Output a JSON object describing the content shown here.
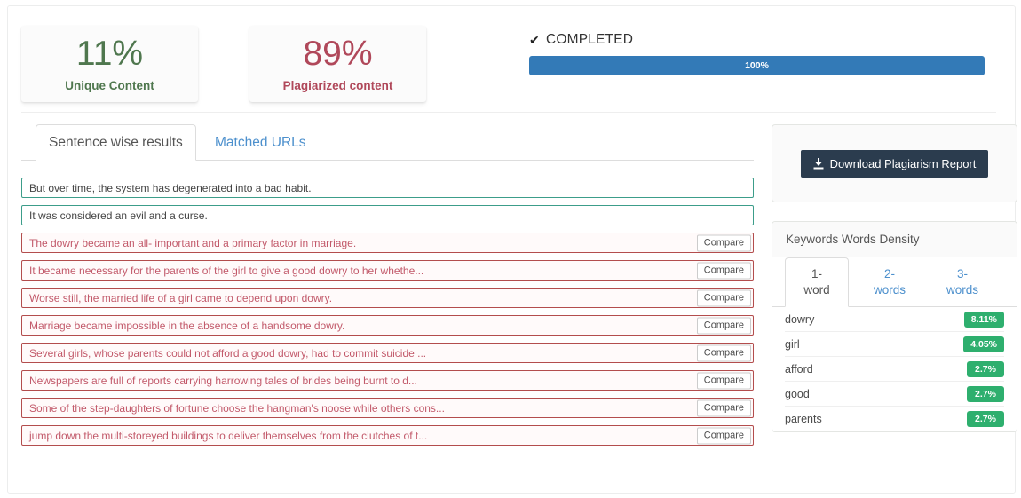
{
  "stats": {
    "unique": {
      "value": "11%",
      "label": "Unique Content",
      "color": "#4f774e"
    },
    "plagiarized": {
      "value": "89%",
      "label": "Plagiarized content",
      "color": "#b0485a"
    }
  },
  "status": {
    "check_icon": "✔",
    "label": "COMPLETED",
    "progress_text": "100%",
    "progress_percent": 100,
    "progress_color": "#337ab7"
  },
  "tabs": [
    {
      "label": "Sentence wise results",
      "active": true
    },
    {
      "label": "Matched URLs",
      "active": false
    }
  ],
  "sentences": [
    {
      "text": "But over time, the system has degenerated into a bad habit.",
      "status": "unique",
      "compare": null
    },
    {
      "text": "It was considered an evil and a curse.",
      "status": "unique",
      "compare": null
    },
    {
      "text": "The dowry became an all- important and a primary factor in marriage.",
      "status": "plagiarized",
      "compare": "Compare"
    },
    {
      "text": "It became necessary for the parents of the girl to give a good dowry to her whethe...",
      "status": "plagiarized",
      "compare": "Compare"
    },
    {
      "text": "Worse still, the married life of a girl came to depend upon dowry.",
      "status": "plagiarized",
      "compare": "Compare"
    },
    {
      "text": "Marriage became impossible in the absence of a handsome dowry.",
      "status": "plagiarized",
      "compare": "Compare"
    },
    {
      "text": "Several girls, whose parents could not afford a good dowry, had to commit suicide ...",
      "status": "plagiarized",
      "compare": "Compare"
    },
    {
      "text": "Newspapers are full of reports carrying harrowing tales of brides being burnt to d...",
      "status": "plagiarized",
      "compare": "Compare"
    },
    {
      "text": "Some of the step-daughters of fortune choose the hangman's noose while others cons...",
      "status": "plagiarized",
      "compare": "Compare"
    },
    {
      "text": "jump down the multi-storeyed buildings to deliver themselves from the clutches of t...",
      "status": "plagiarized",
      "compare": "Compare"
    }
  ],
  "download": {
    "label": "Download Plagiarism Report",
    "icon": "download-icon",
    "color": "#2b3c4e"
  },
  "keywords_panel": {
    "title": "Keywords Words Density",
    "tabs": [
      {
        "line1": "1-",
        "line2": "word",
        "active": true
      },
      {
        "line1": "2-",
        "line2": "words",
        "active": false
      },
      {
        "line1": "3-",
        "line2": "words",
        "active": false
      }
    ],
    "badge_color": "#2eaf6e",
    "rows": [
      {
        "word": "dowry",
        "density": "8.11%"
      },
      {
        "word": "girl",
        "density": "4.05%"
      },
      {
        "word": "afford",
        "density": "2.7%"
      },
      {
        "word": "good",
        "density": "2.7%"
      },
      {
        "word": "parents",
        "density": "2.7%"
      }
    ]
  }
}
